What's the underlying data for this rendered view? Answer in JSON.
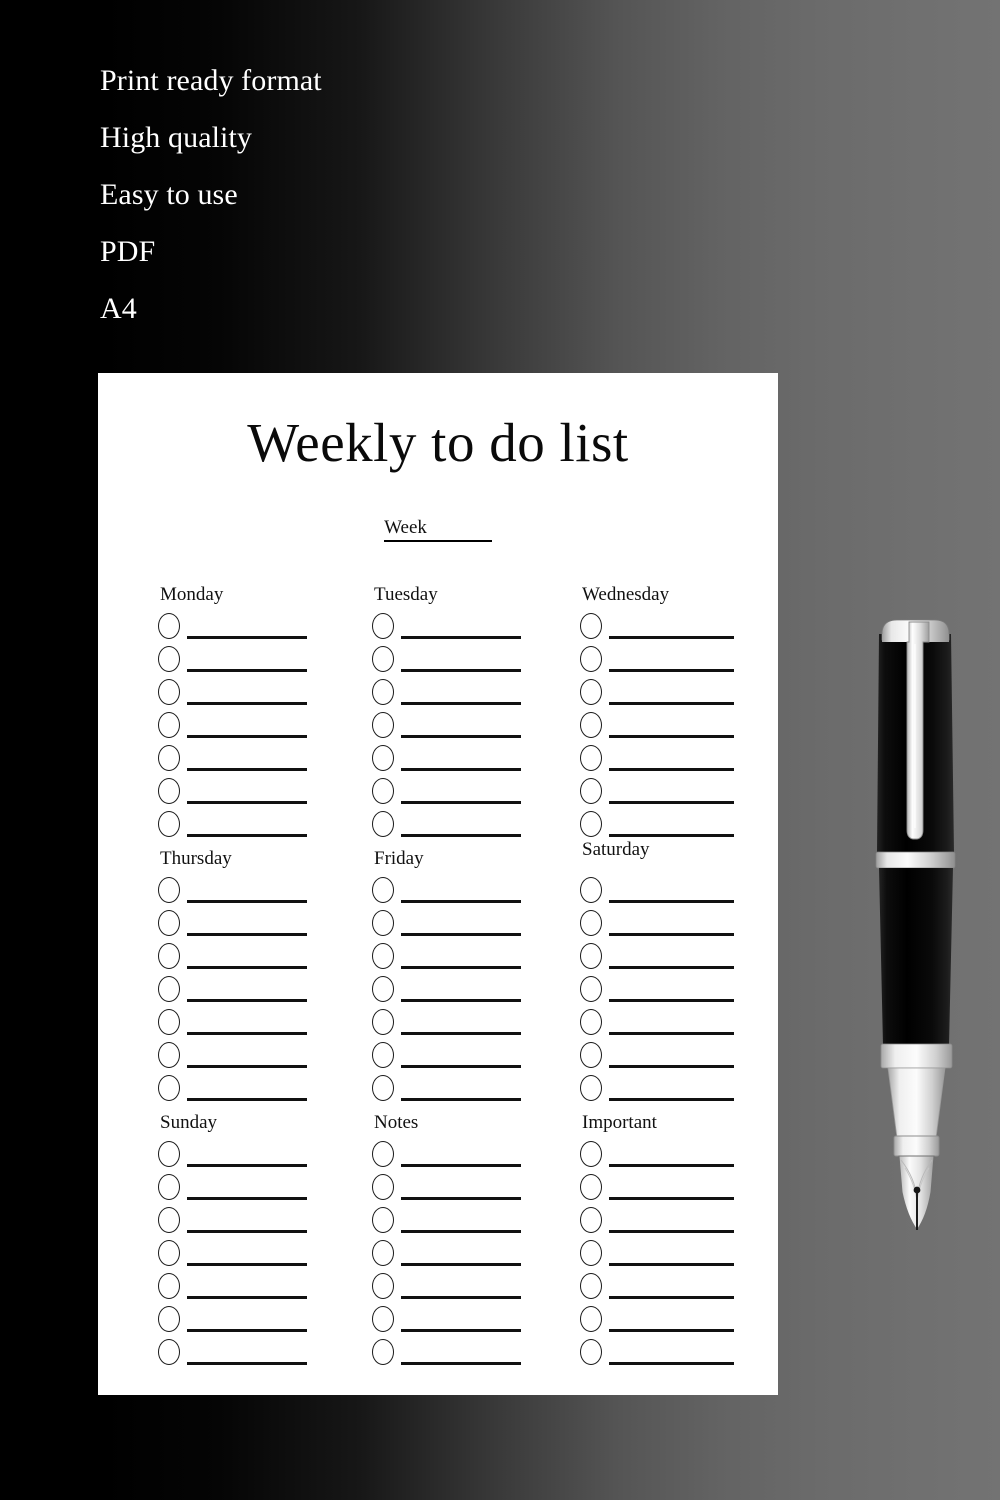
{
  "promo": {
    "lines": [
      "Print ready format",
      "High quality",
      "Easy to use",
      "PDF",
      "A4"
    ]
  },
  "sheet": {
    "title": "Weekly to do list",
    "week_label": "Week",
    "week_value": "",
    "rows_per_column": 7,
    "columns": [
      {
        "label": "Monday",
        "rule_width": 120
      },
      {
        "label": "Tuesday",
        "rule_width": 120
      },
      {
        "label": "Wednesday",
        "rule_width": 125
      },
      {
        "label": "Thursday",
        "rule_width": 120
      },
      {
        "label": "Friday",
        "rule_width": 120
      },
      {
        "label": "Saturday",
        "rule_width": 125
      },
      {
        "label": "Sunday",
        "rule_width": 120
      },
      {
        "label": "Notes",
        "rule_width": 120
      },
      {
        "label": "Important",
        "rule_width": 125
      }
    ]
  },
  "decor": {
    "pen": "fountain-pen"
  },
  "colors": {
    "background_left": "#000000",
    "background_right": "#737373",
    "sheet": "#ffffff",
    "ink": "#111111",
    "promo_text": "#ffffff",
    "pen_body": "#0b0b0b",
    "pen_metal": "#d9d9d9"
  }
}
